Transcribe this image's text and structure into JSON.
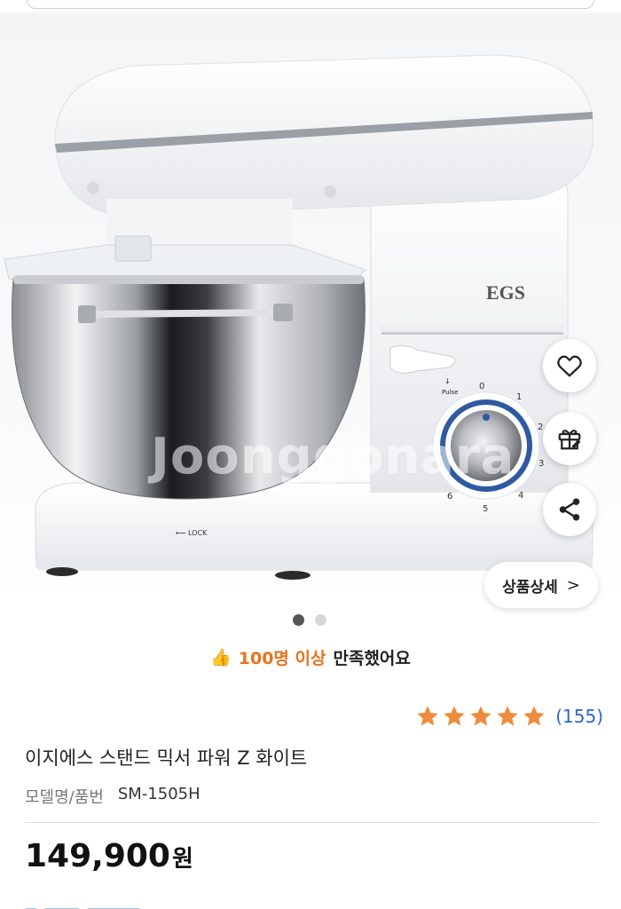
{
  "floating": {
    "like_icon": "heart-icon",
    "gift_icon": "gift-icon",
    "share_icon": "share-icon"
  },
  "detail_button": {
    "label": "상품상세",
    "chevron": ">"
  },
  "gallery": {
    "pages": 2,
    "current": 1
  },
  "satisfaction": {
    "emoji": "👍",
    "highlight": "100명 이상",
    "rest": "만족했어요",
    "highlight_color": "#e8731a"
  },
  "rating": {
    "stars": 5,
    "max": 5,
    "count_text": "(155)",
    "star_color": "#f08a3c",
    "count_color": "#2f62d6"
  },
  "product": {
    "title": "이지에스 스탠드 믹서 파워 Z 화이트",
    "model_label": "모델명/품번",
    "model_value": "SM-1505H",
    "price": "149,900",
    "price_unit": "원"
  },
  "image": {
    "watermark": "Joonggonara",
    "brand_on_product": "EGS",
    "dial_labels": [
      "0",
      "1",
      "2",
      "3",
      "4",
      "5",
      "6"
    ],
    "pulse_label": "Pulse",
    "lock_label": "LOCK"
  }
}
